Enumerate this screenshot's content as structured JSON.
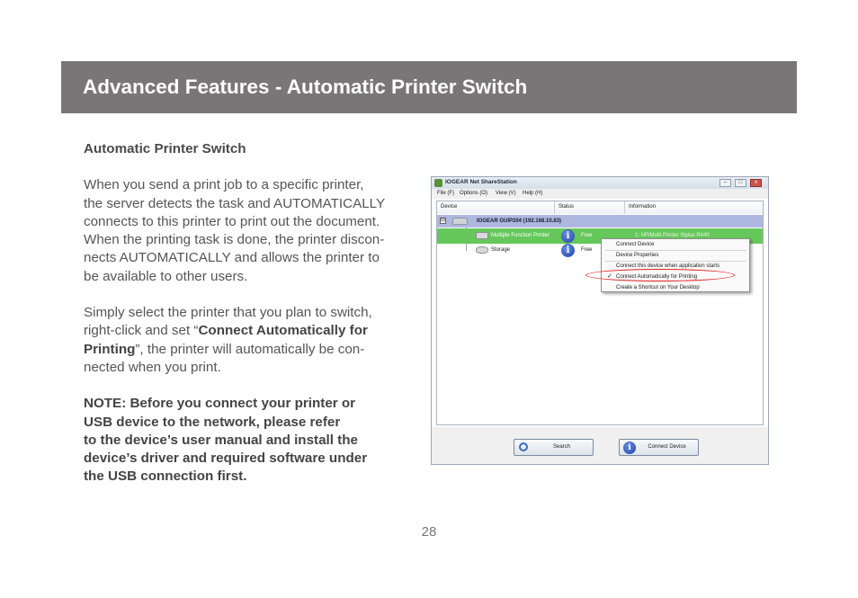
{
  "header": {
    "title": "Advanced Features - Automatic Printer Switch"
  },
  "content": {
    "subheading": "Automatic Printer Switch",
    "paragraph1_lines": [
      "When you send a print job to a specific printer,",
      "the server detects the task and AUTOMATICALLY",
      "connects to this printer to print out the document.",
      "When the printing task is done, the printer discon-",
      "nects AUTOMATICALLY and allows the printer to",
      "be available to other users."
    ],
    "paragraph2": {
      "line1": "Simply select the printer that you plan to switch,",
      "line2_pre": "right-click and set “",
      "line2_bold": "Connect Automatically for",
      "line3_bold": "Printing",
      "line3_post": "”, the printer will automatically be con-",
      "line4": "nected when you print."
    },
    "note_lines": [
      "NOTE: Before you connect your printer or",
      "USB device to the network, please refer",
      "to the device’s user manual and install the",
      "device’s driver and required software under",
      "the USB connection first."
    ]
  },
  "screenshot": {
    "window_title": "IOGEAR Net ShareStation",
    "window_buttons": {
      "minimize": "–",
      "maximize": "□",
      "close": "x"
    },
    "menu": [
      "File (F)",
      "Options (O)",
      "View (V)",
      "Help (H)"
    ],
    "columns": [
      "Device",
      "Status",
      "Information"
    ],
    "server": {
      "expand": "⊟",
      "label": "IOGEAR GUIP204  (192.168.10.83)"
    },
    "devices": [
      {
        "label": "Multiple Function Printer",
        "status": "Free",
        "info": "1: HP/Multi Printer Stylus R440",
        "selected": true
      },
      {
        "label": "Storage",
        "status": "Free",
        "info": "",
        "selected": false
      }
    ],
    "context_menu": {
      "items": [
        "Connect Device",
        "Device Properties",
        "Connect this device when application starts",
        "Connect Automatically for Printing",
        "Create a Shortcut on Your Desktop"
      ],
      "checked_item": "✓"
    },
    "buttons": {
      "search": "Search",
      "connect": "Connect Device"
    },
    "info_glyph": "i"
  },
  "footer": {
    "page_number": "28"
  },
  "colors": {
    "banner": "#7a7677",
    "selected_row": "#66c75b",
    "server_row": "#aeb7e0",
    "highlight_ellipse": "#e0201c"
  }
}
